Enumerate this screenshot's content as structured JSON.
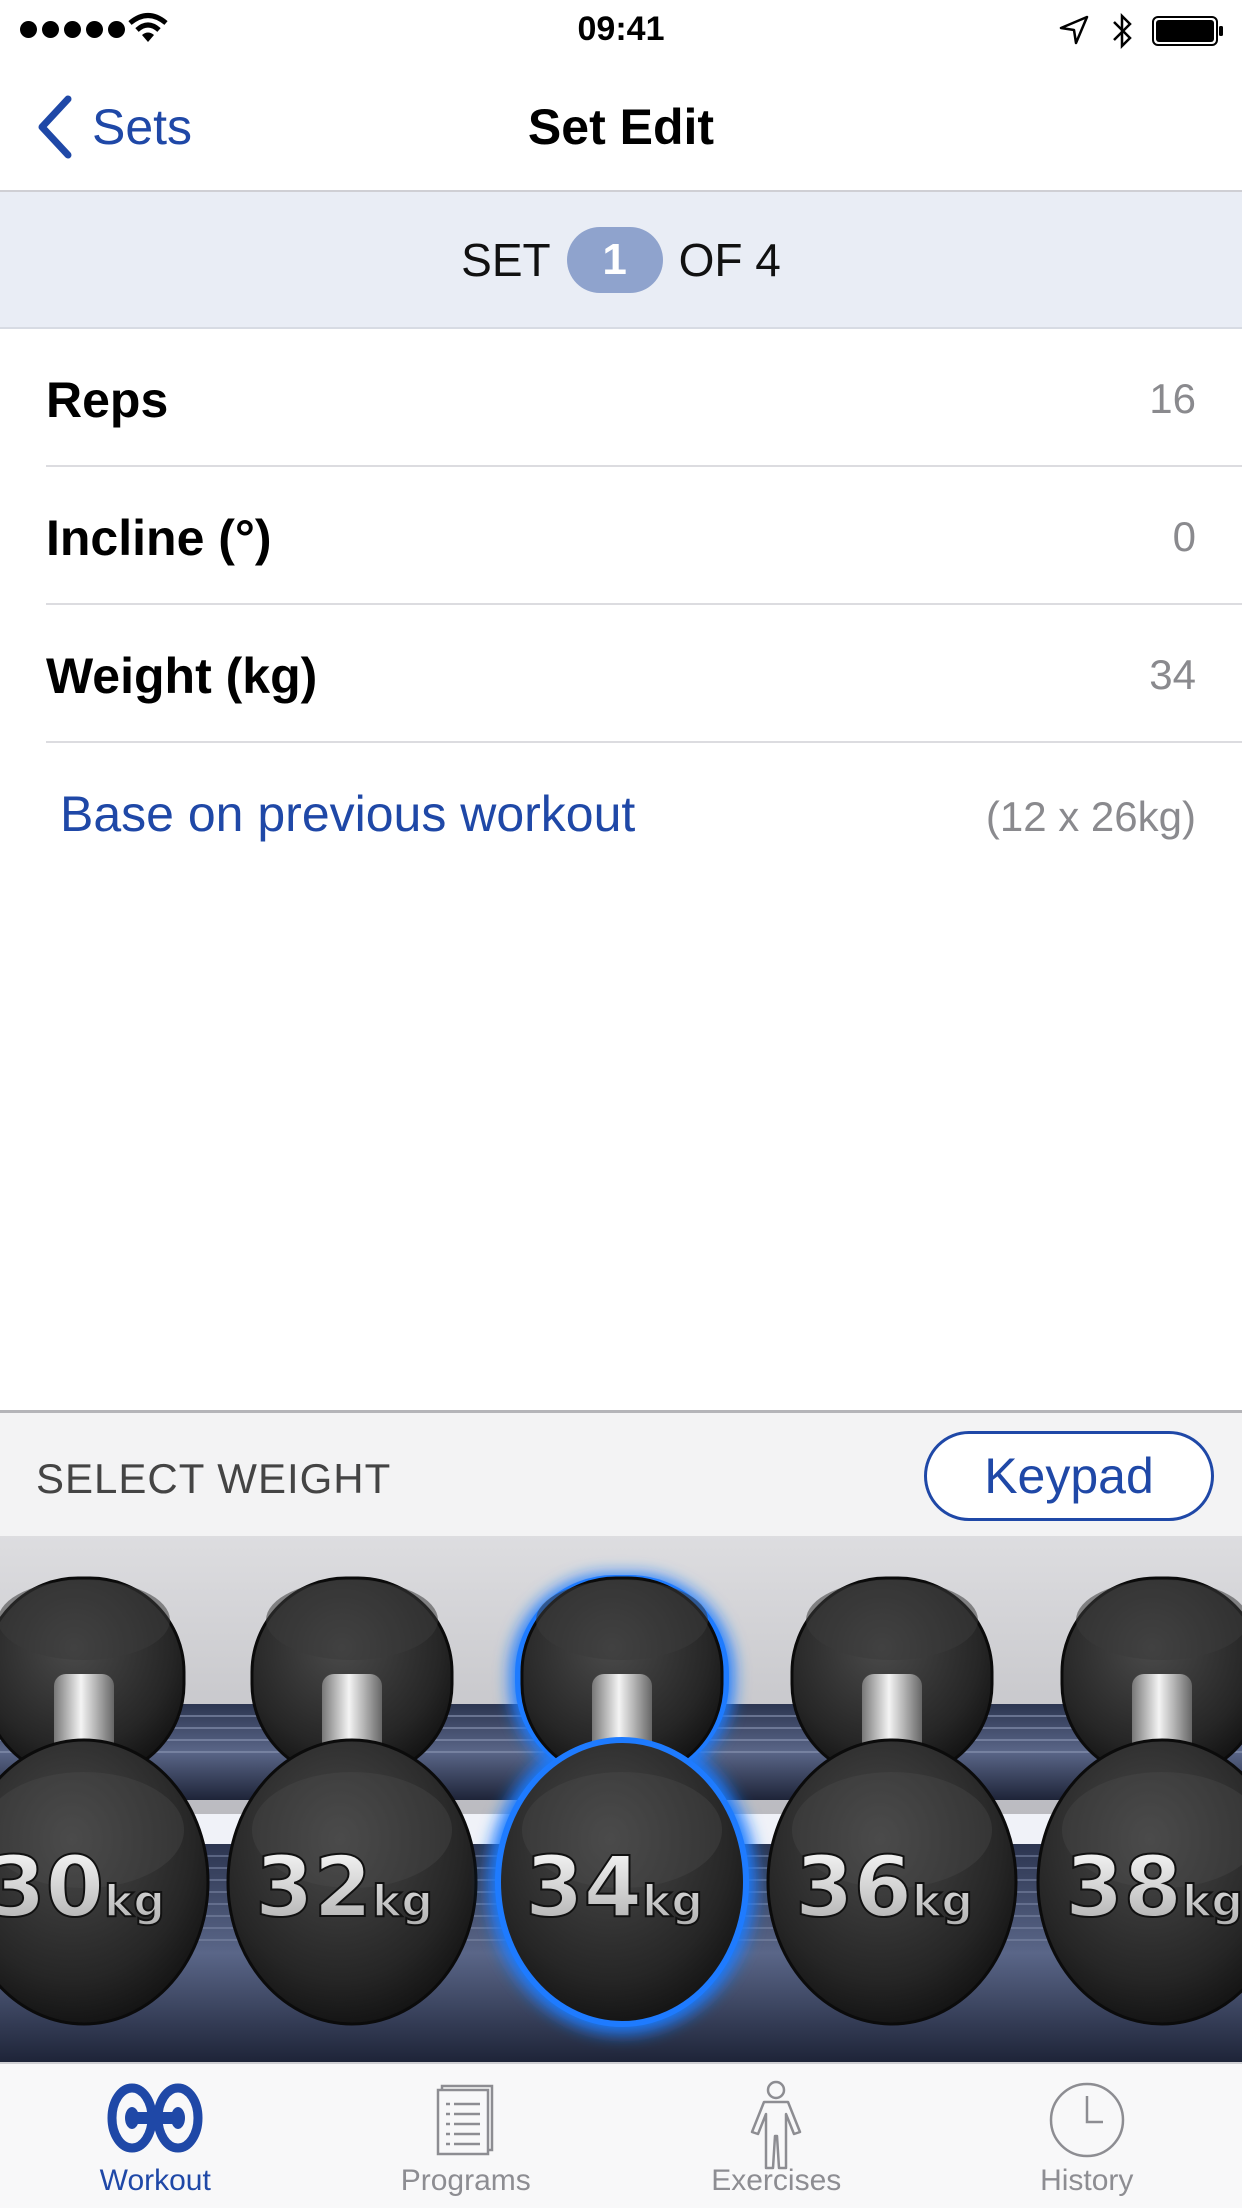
{
  "status_bar": {
    "time": "09:41"
  },
  "nav": {
    "back_label": "Sets",
    "title": "Set Edit"
  },
  "set_header": {
    "prefix": "SET",
    "current": "1",
    "suffix": "OF 4"
  },
  "rows": {
    "reps": {
      "label": "Reps",
      "value": "16"
    },
    "incline": {
      "label": "Incline (°)",
      "value": "0"
    },
    "weight": {
      "label": "Weight (kg)",
      "value": "34"
    }
  },
  "base": {
    "link": "Base on previous workout",
    "previous": "(12 x 26kg)"
  },
  "select_weight": {
    "label": "SELECT WEIGHT",
    "keypad": "Keypad"
  },
  "dumbbells": [
    {
      "num": "30",
      "unit": "kg",
      "selected": false
    },
    {
      "num": "32",
      "unit": "kg",
      "selected": false
    },
    {
      "num": "34",
      "unit": "kg",
      "selected": true
    },
    {
      "num": "36",
      "unit": "kg",
      "selected": false
    },
    {
      "num": "38",
      "unit": "kg",
      "selected": false
    }
  ],
  "tabs": [
    {
      "label": "Workout",
      "icon": "workout-icon",
      "active": true
    },
    {
      "label": "Programs",
      "icon": "programs-icon",
      "active": false
    },
    {
      "label": "Exercises",
      "icon": "exercises-icon",
      "active": false
    },
    {
      "label": "History",
      "icon": "history-icon",
      "active": false
    }
  ],
  "colors": {
    "accent": "#1f48a7",
    "header_bg": "#e9edf5",
    "pill": "#8fa3cd",
    "selection_glow": "#1e7bff"
  }
}
